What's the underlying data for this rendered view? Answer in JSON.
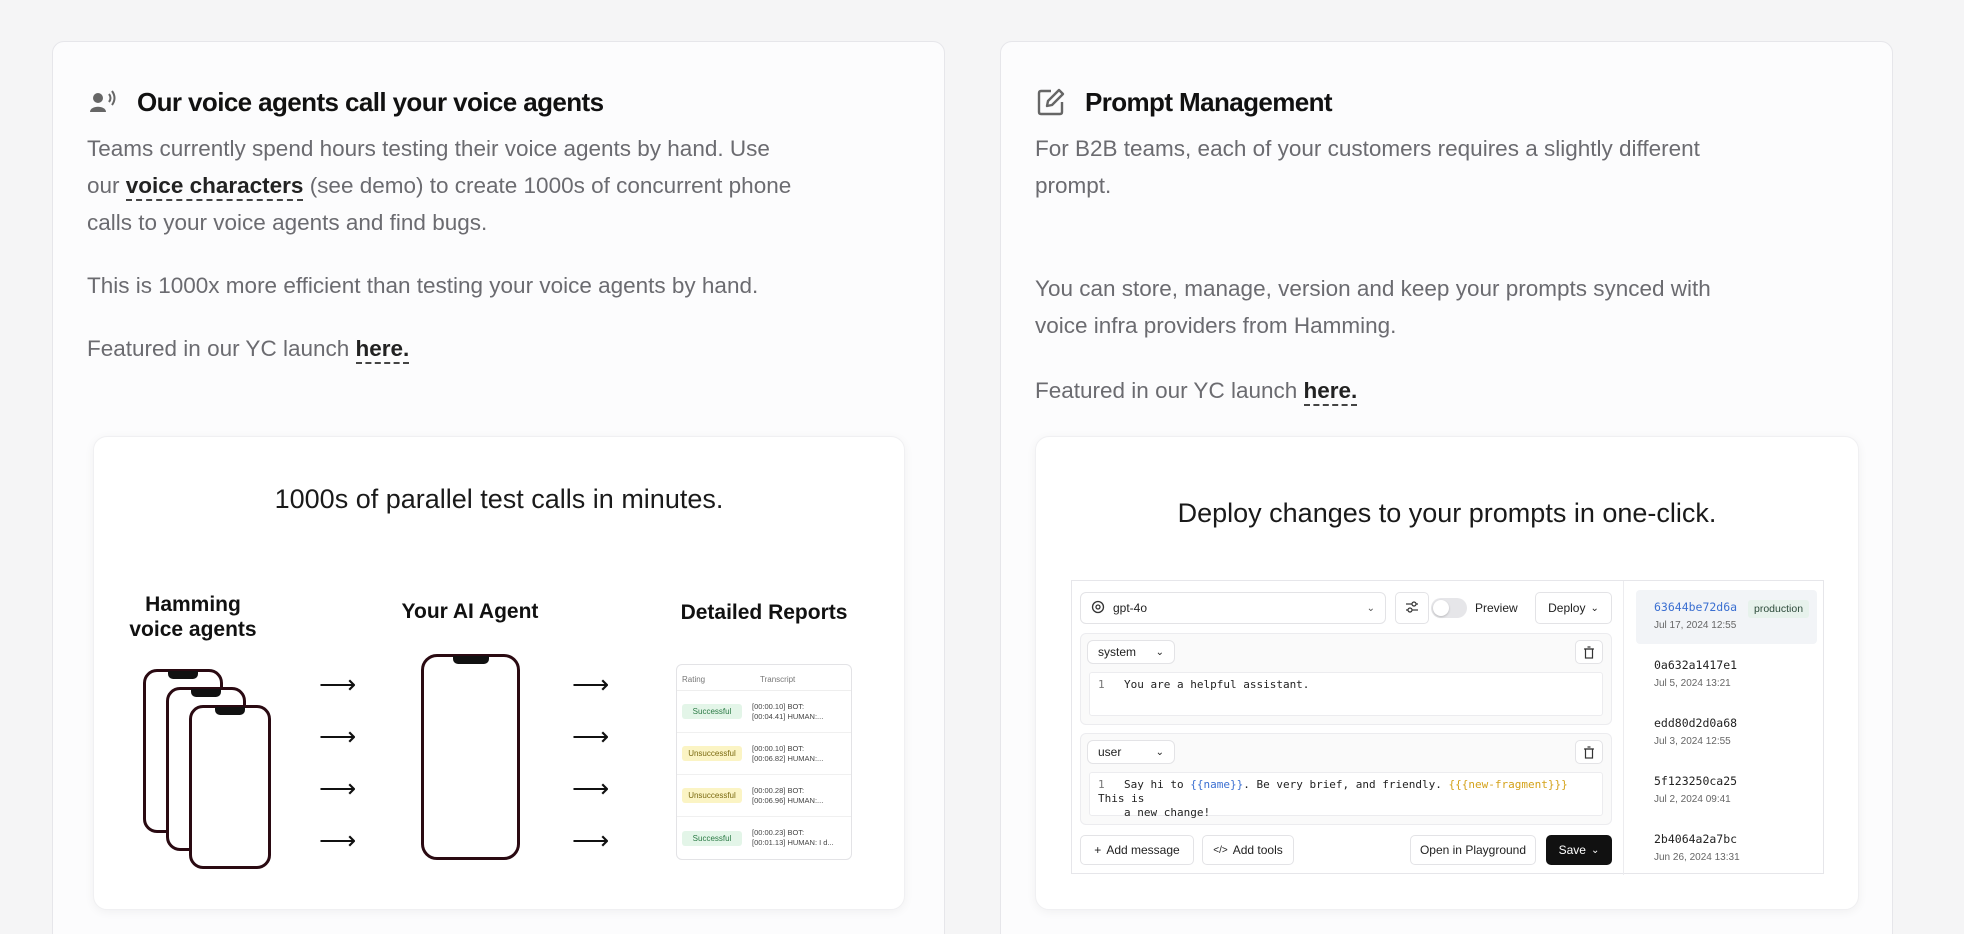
{
  "left_card": {
    "title": "Our voice agents call your voice agents",
    "p1_a": "Teams currently spend hours testing their voice agents by hand. Use",
    "p1_b": "our",
    "p1_link": "voice characters",
    "p1_c": "(see demo) to create 1000s of concurrent phone",
    "p1_d": "calls to your voice agents and find bugs.",
    "p2": "This is 1000x more efficient than testing your voice agents by hand.",
    "p3": "Featured in our YC launch",
    "p3_link": "here.",
    "illustration": {
      "caption": "1000s of parallel test calls in minutes.",
      "col1": "Hamming\nvoice agents",
      "col2": "Your AI Agent",
      "col3": "Detailed Reports",
      "arrow": "⟶",
      "report": {
        "headers": [
          "Rating",
          "Transcript"
        ],
        "rows": [
          {
            "status": "Successful",
            "kind": "ok",
            "transcript": "[00:00.10] BOT:\n[00:04.41] HUMAN:..."
          },
          {
            "status": "Unsuccessful",
            "kind": "bad",
            "transcript": "[00:00.10] BOT:\n[00:06.82] HUMAN:..."
          },
          {
            "status": "Unsuccessful",
            "kind": "bad",
            "transcript": "[00:00.28] BOT:\n[00:06.96] HUMAN:..."
          },
          {
            "status": "Successful",
            "kind": "ok",
            "transcript": "[00:00.23] BOT:\n[00:01.13] HUMAN: I d..."
          }
        ]
      }
    }
  },
  "right_card": {
    "title": "Prompt Management",
    "p1_a": "For B2B teams, each of your customers requires a slightly different",
    "p1_b": "prompt.",
    "p2_a": "You can store, manage, version and keep your prompts synced with",
    "p2_b": "voice infra providers from Hamming.",
    "p3": "Featured in our YC launch",
    "p3_link": "here.",
    "illustration": {
      "caption": "Deploy changes to your prompts in one-click.",
      "model": "gpt-4o",
      "preview_label": "Preview",
      "deploy_label": "Deploy",
      "messages": [
        {
          "role": "system",
          "line_no": "1",
          "content": "You are a helpful assistant."
        },
        {
          "role": "user",
          "line_no": "1",
          "c1": "Say hi to ",
          "v1": "{{name}}",
          "c2": ". Be very brief, and friendly. ",
          "v2": "{{{new-fragment}}}",
          "c3": " This is",
          "c4": "a new change!"
        }
      ],
      "add_message": "Add message",
      "add_tools": "Add tools",
      "open_playground": "Open in Playground",
      "save": "Save",
      "versions": [
        {
          "hash": "63644be72d6a",
          "date": "Jul 17, 2024 12:55",
          "tag": "production"
        },
        {
          "hash": "0a632a1417e1",
          "date": "Jul 5, 2024 13:21"
        },
        {
          "hash": "edd80d2d0a68",
          "date": "Jul 3, 2024 12:55"
        },
        {
          "hash": "5f123250ca25",
          "date": "Jul 2, 2024 09:41"
        },
        {
          "hash": "2b4064a2a7bc",
          "date": "Jun 26, 2024 13:31"
        }
      ]
    }
  }
}
